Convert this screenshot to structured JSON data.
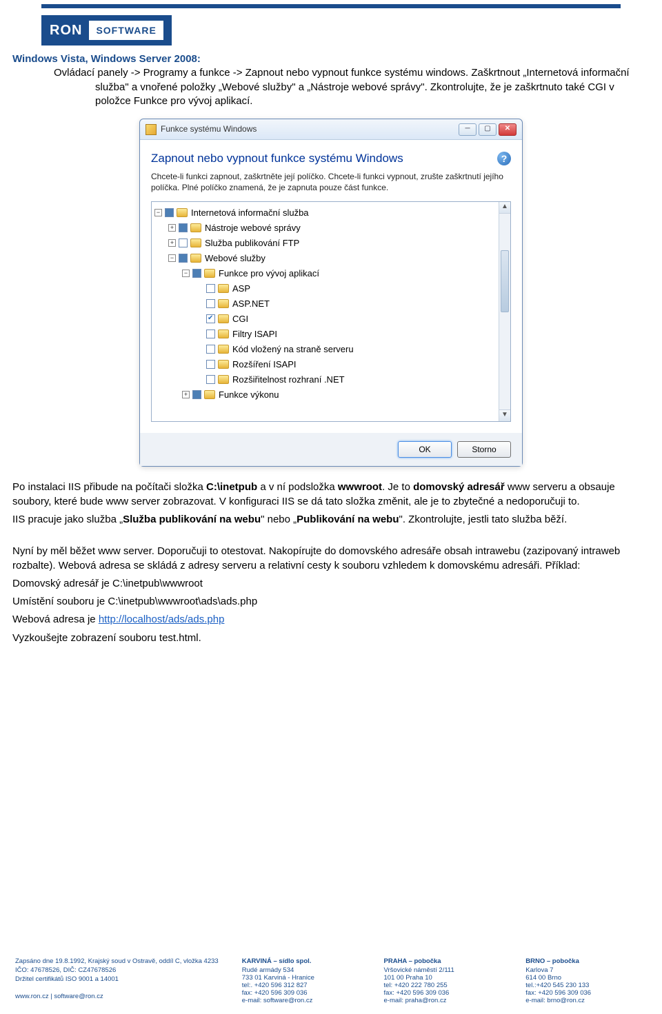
{
  "document": {
    "heading_line1": "Windows Vista, Windows Server 2008:",
    "para1_a": "Ovládací panely -> Programy a funkce -> Zapnout nebo vypnout funkce systému windows. Zaškrtnout „Internetová informační služba\" a vnořené položky „Webové služby\" a „Nástroje webové správy\". Zkontrolujte, že je zaškrtnuto také CGI v položce Funkce pro vývoj aplikací.",
    "para2_a": "Po instalaci IIS přibude na počítači složka ",
    "para2_b": "C:\\inetpub",
    "para2_c": " a v ní podsložka ",
    "para2_d": "wwwroot",
    "para2_e": ". Je to ",
    "para2_f": "domovský adresář",
    "para2_g": " www serveru a obsauje soubory, které bude www server zobrazovat. V konfiguraci IIS se dá tato složka změnit, ale je to zbytečné a nedoporučuji to.",
    "para3_a": "IIS pracuje jako služba „",
    "para3_b": "Služba publikování na webu",
    "para3_c": "\" nebo „",
    "para3_d": "Publikování na webu",
    "para3_e": "\". Zkontrolujte, jestli tato služba běží.",
    "para4": "Nyní by měl běžet www server. Doporučuji to otestovat. Nakopírujte do domovského adresáře obsah intrawebu (zazipovaný intraweb rozbalte). Webová adresa se skládá z adresy serveru a relativní cesty k souboru vzhledem k domovskému adresáři. Příklad:",
    "para4_line2": "Domovský adresář je C:\\inetpub\\wwwroot",
    "para4_line3": "Umístění souboru je C:\\inetpub\\wwwroot\\ads\\ads.php",
    "para4_line4a": "Webová adresa je ",
    "para4_link": "http://localhost/ads/ads.php",
    "para4_line5": "Vyzkoušejte zobrazení souboru test.html."
  },
  "window": {
    "title": "Funkce systému Windows",
    "heading": "Zapnout nebo vypnout funkce systému Windows",
    "desc": "Chcete-li funkci zapnout, zaškrtněte její políčko. Chcete-li funkci vypnout, zrušte zaškrtnutí jejího políčka. Plné políčko znamená, že je zapnuta pouze část funkce.",
    "ok": "OK",
    "cancel": "Storno",
    "tree": [
      {
        "indent": 0,
        "toggle": "-",
        "chk": "partial",
        "label": "Internetová informační služba"
      },
      {
        "indent": 1,
        "toggle": "+",
        "chk": "partial",
        "label": "Nástroje webové správy"
      },
      {
        "indent": 1,
        "toggle": "+",
        "chk": "",
        "label": "Služba publikování FTP"
      },
      {
        "indent": 1,
        "toggle": "-",
        "chk": "partial",
        "label": "Webové služby"
      },
      {
        "indent": 2,
        "toggle": "-",
        "chk": "partial",
        "label": "Funkce pro vývoj aplikací"
      },
      {
        "indent": 3,
        "toggle": "",
        "chk": "",
        "label": "ASP"
      },
      {
        "indent": 3,
        "toggle": "",
        "chk": "",
        "label": "ASP.NET"
      },
      {
        "indent": 3,
        "toggle": "",
        "chk": "checked",
        "label": "CGI"
      },
      {
        "indent": 3,
        "toggle": "",
        "chk": "",
        "label": "Filtry ISAPI"
      },
      {
        "indent": 3,
        "toggle": "",
        "chk": "",
        "label": "Kód vložený na straně serveru"
      },
      {
        "indent": 3,
        "toggle": "",
        "chk": "",
        "label": "Rozšíření ISAPI"
      },
      {
        "indent": 3,
        "toggle": "",
        "chk": "",
        "label": "Rozšiřitelnost rozhraní .NET"
      },
      {
        "indent": 2,
        "toggle": "+",
        "chk": "partial",
        "label": "Funkce výkonu"
      }
    ]
  },
  "footer": {
    "left_line1": "Zapsáno dne 19.8.1992, Krajský soud v Ostravě, oddíl C, vložka 4233",
    "left_line2": "IČO: 47678526, DIČ: CZ47678526",
    "left_line3": "Držitel certifikátů ISO 9001 a 14001",
    "left_line4": "www.ron.cz | software@ron.cz",
    "offices": [
      {
        "name": "KARVINÁ – sídlo spol.",
        "addr1": "Rudé armády 534",
        "addr2": "733 01 Karviná - Hranice",
        "tel": "tel:. +420 596 312 827",
        "fax": "fax: +420 596 309 036",
        "email": "e-mail: software@ron.cz"
      },
      {
        "name": "PRAHA – pobočka",
        "addr1": "Vršovické náměstí 2/111",
        "addr2": "101 00 Praha 10",
        "tel": "tel: +420 222 780 255",
        "fax": "fax: +420 596 309 036",
        "email": "e-mail: praha@ron.cz"
      },
      {
        "name": "BRNO – pobočka",
        "addr1": "Karlova 7",
        "addr2": "614 00 Brno",
        "tel": "tel.:+420 545 230 133",
        "fax": "fax: +420 596 309 036",
        "email": "e-mail: brno@ron.cz"
      }
    ]
  },
  "logo": {
    "ron": "RON",
    "sw": "SOFTWARE"
  }
}
